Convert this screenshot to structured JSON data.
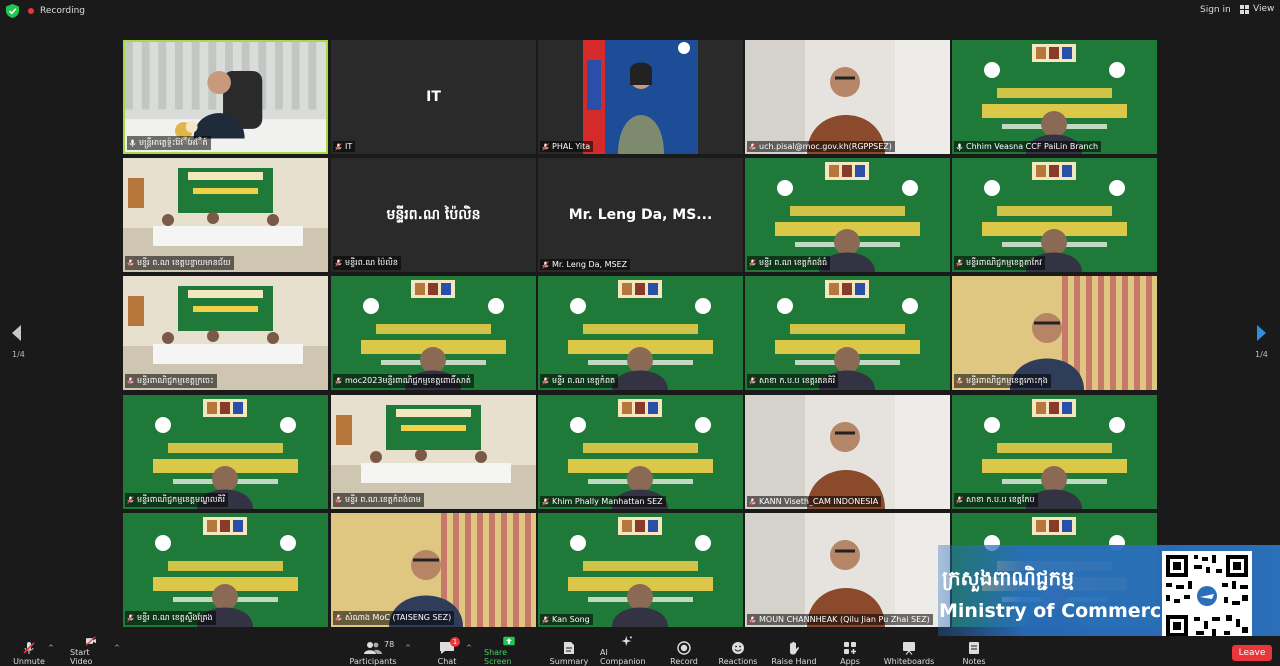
{
  "topbar": {
    "recording_label": "Recording",
    "signin_label": "Sign in",
    "view_label": "View"
  },
  "pagination": {
    "left": "1/4",
    "right": "1/4"
  },
  "participants": [
    {
      "name": "មន្ត្រីអាត្លេទ្ញ៉ះរ៉ែ៊ែីអែ៊ែិត៍",
      "muted": false,
      "speaking": true,
      "scene": "office"
    },
    {
      "name": "IT",
      "muted": true,
      "center_name": "IT",
      "scene": "blank"
    },
    {
      "name": "PHAL Yita",
      "muted": true,
      "scene": "flag"
    },
    {
      "name": "uch.pisal@moc.gov.kh(RGPPSEZ)",
      "muted": true,
      "scene": "person"
    },
    {
      "name": "Chhim Veasna CCF PaiLin Branch",
      "muted": false,
      "scene": "greenbanner"
    },
    {
      "name": "មន្ទីរ ព.ណ ខេត្តបន្ទាយមានជ័យ",
      "muted": true,
      "scene": "meetingroom"
    },
    {
      "name": "មន្ទីរព.ណ ប៉ៃលិន",
      "muted": true,
      "center_name": "មន្ទីរព.ណ ប៉ៃលិន",
      "scene": "blank"
    },
    {
      "name": "Mr. Leng Da, MSEZ",
      "muted": true,
      "center_name": "Mr. Leng Da, MS...",
      "scene": "blank"
    },
    {
      "name": "មន្ទីរ ព.ណ ខេត្តកំពង់ធំ",
      "muted": true,
      "scene": "greenbanner"
    },
    {
      "name": "មន្ទីរពាណិជ្ជកម្មខេត្តតាកែវ",
      "muted": true,
      "scene": "greenbanner"
    },
    {
      "name": "មន្ទីរពាណិជ្ជកម្មខេត្តក្រចេះ",
      "muted": true,
      "scene": "meetingroom"
    },
    {
      "name": "moc2023មន្ទីរពាណិជ្ជកម្មខេត្តពោធិ៍សាត់",
      "muted": true,
      "scene": "greenbanner"
    },
    {
      "name": "មន្ទីរ ព.ណ ខេត្តកំពត",
      "muted": true,
      "scene": "greenbanner"
    },
    {
      "name": "សាខា ក.ប.ប ខេត្តរតនគិរី",
      "muted": true,
      "scene": "greenbanner"
    },
    {
      "name": "មន្ទីរពាណិជ្ជកម្មខេត្តកោះកុង",
      "muted": true,
      "scene": "curtain"
    },
    {
      "name": "មន្ទីរពាណិជ្ជកម្មខេត្តមណ្ឌលគិរី",
      "muted": true,
      "scene": "greenbanner"
    },
    {
      "name": "មន្ទីរ ព.ណ.ខេត្តកំពង់ចាម",
      "muted": true,
      "scene": "meetingroom"
    },
    {
      "name": "Khim Phally Manhattan SEZ",
      "muted": true,
      "scene": "greenbanner"
    },
    {
      "name": "KANN Viseth_CAM INDONESIA",
      "muted": true,
      "scene": "person"
    },
    {
      "name": "សាខា ក.ប.ប ខេត្តកែប",
      "muted": true,
      "scene": "greenbanner"
    },
    {
      "name": "មន្ទីរ ព.ណ ខេត្តស្ទឹងត្រែង",
      "muted": true,
      "scene": "greenbanner"
    },
    {
      "name": "សំណាង MoC (TAISENG SEZ)",
      "muted": true,
      "scene": "curtain"
    },
    {
      "name": "Kan Song",
      "muted": true,
      "scene": "greenbanner"
    },
    {
      "name": "MOUN CHANNHEAK (Qilu Jian Pu Zhai SEZ)",
      "muted": true,
      "scene": "person"
    },
    {
      "name": "",
      "muted": true,
      "scene": "greenbanner"
    }
  ],
  "banner": {
    "khmer_title": "ក្រសួងពាណិជ្ជកម្ម",
    "english_title": "Ministry of Commerce"
  },
  "toolbar": {
    "unmute_label": "Unmute",
    "start_video_label": "Start Video",
    "participants_label": "Participants",
    "participants_count": "78",
    "chat_label": "Chat",
    "chat_badge": "1",
    "share_screen_label": "Share Screen",
    "summary_label": "Summary",
    "ai_companion_label": "AI Companion",
    "record_label": "Record",
    "reactions_label": "Reactions",
    "raise_hand_label": "Raise Hand",
    "apps_label": "Apps",
    "whiteboards_label": "Whiteboards",
    "notes_label": "Notes",
    "leave_label": "Leave"
  },
  "colors": {
    "accent_green": "#a8d946",
    "danger_red": "#e8363b",
    "banner_green": "#1f7a3a",
    "moc_blue": "#2b6fb8"
  }
}
